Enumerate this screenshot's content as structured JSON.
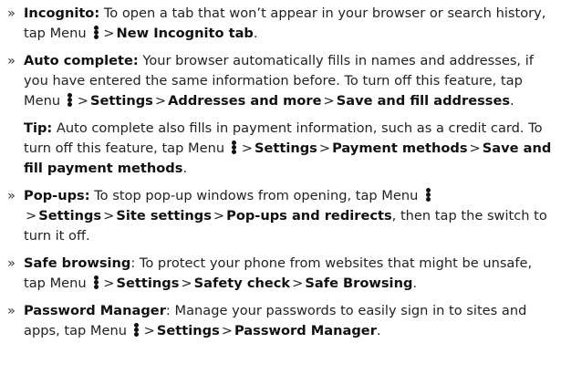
{
  "bullet": "»",
  "separator": ">",
  "items": [
    {
      "title": "Incognito:",
      "text1": " To open a tab that won’t appear in your browser or search history, tap Menu ",
      "step1": "New Incognito tab",
      "end": "."
    },
    {
      "title": "Auto complete:",
      "text1": " Your browser automatically fills in names and addresses, if you have entered the same information before. To turn off this feature, tap Menu ",
      "step1": "Settings",
      "step2": "Addresses and more",
      "step3": "Save and fill addresses",
      "end": "."
    },
    {
      "title": "Tip:",
      "text1": " Auto complete also fills in payment information, such as a credit card. To turn off this feature, tap Menu ",
      "step1": "Settings",
      "step2": "Payment methods",
      "step3": "Save and fill payment methods",
      "end": "."
    },
    {
      "title": "Pop-ups:",
      "text1": " To stop pop-up windows from opening, tap Menu ",
      "step1": "Settings",
      "step2": "Site settings",
      "step3": "Pop-ups and redirects",
      "end": ", then tap the switch to turn it off."
    },
    {
      "title": "Safe browsing",
      "text1": ": To protect your phone from websites that might be unsafe, tap Menu ",
      "step1": "Settings",
      "step2": "Safety check",
      "step3": "Safe Browsing",
      "end": "."
    },
    {
      "title": "Password Manager",
      "text1": ": Manage your passwords to easily sign in to sites and apps, tap Menu ",
      "step1": "Settings",
      "step2": "Password Manager",
      "end": "."
    }
  ],
  "icons": {
    "menu": "more-vert-icon"
  }
}
